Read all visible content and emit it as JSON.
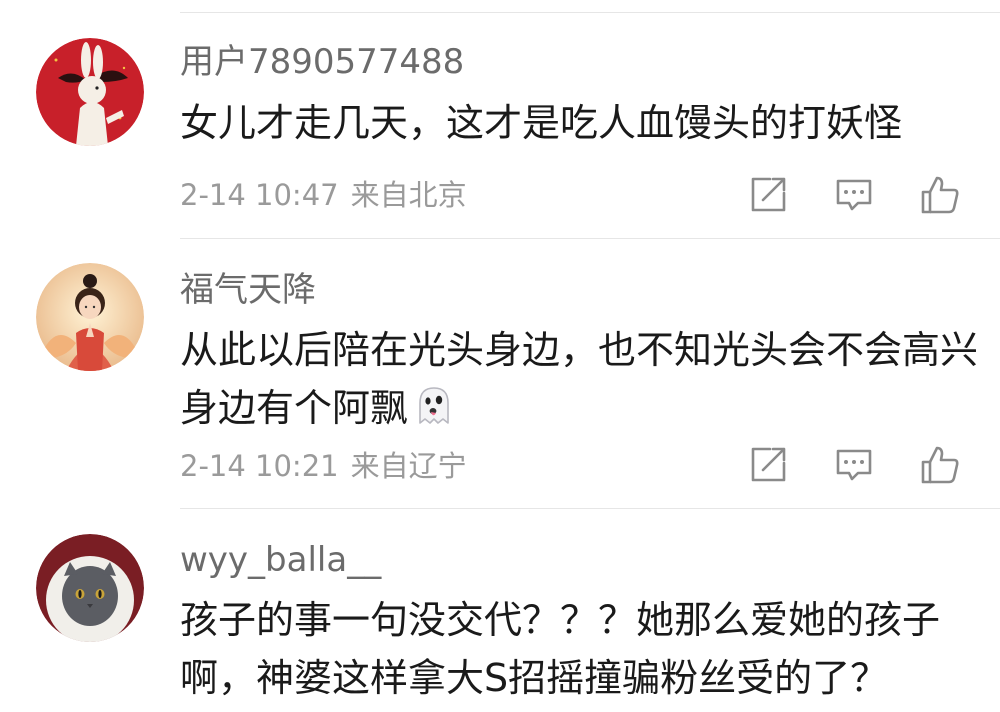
{
  "comments": [
    {
      "username": "用户7890577488",
      "text": "女儿才走几天，这才是吃人血馒头的打妖怪",
      "time": "2-14 10:47",
      "location": "来自北京",
      "avatar_icon": "red-rabbit-avatar",
      "avatar_color": "#c8202a"
    },
    {
      "username": "福气天降",
      "text": "从此以后陪在光头身边，也不知光头会不会高兴身边有个阿飘",
      "emoji": "ghost-emoji",
      "time": "2-14 10:21",
      "location": "来自辽宁",
      "avatar_icon": "praying-girl-lotus-avatar",
      "avatar_color": "#e8a060"
    },
    {
      "username": "wyy_balla__",
      "text": "孩子的事一句没交代？？？她那么爱她的孩子啊，神婆这样拿大S招摇撞骗粉丝受的了？",
      "avatar_icon": "grey-cat-in-hood-avatar",
      "avatar_color": "#7a1e24"
    }
  ],
  "actions": {
    "share_icon": "share-icon",
    "comment_icon": "comment-icon",
    "like_icon": "like-icon"
  },
  "colors": {
    "username": "#6b6b6b",
    "meta": "#9a9a9a",
    "text": "#1a1a1a",
    "divider": "#e6e6e6"
  }
}
